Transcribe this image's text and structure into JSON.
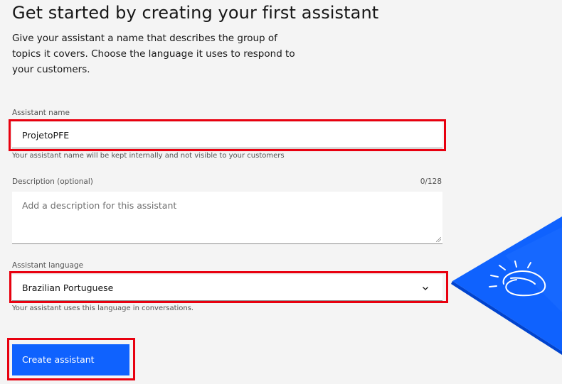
{
  "header": {
    "title": "Get started by creating your first assistant",
    "intro": "Give your assistant a name that describes the group of topics it covers. Choose the language it uses to respond to your customers."
  },
  "form": {
    "name": {
      "label": "Assistant name",
      "value": "ProjetoPFE",
      "helper": "Your assistant name will be kept internally and not visible to your customers"
    },
    "description": {
      "label": "Description (optional)",
      "counter": "0/128",
      "placeholder": "Add a description for this assistant"
    },
    "language": {
      "label": "Assistant language",
      "selected": "Brazilian Portuguese",
      "helper": "Your assistant uses this language in conversations."
    },
    "create_button": "Create assistant"
  },
  "icons": {
    "select_chevron": "chevron-down-icon",
    "illustration": "watson-planet-illustration"
  },
  "colors": {
    "background": "#f4f4f4",
    "primary_button": "#0f62fe",
    "highlight": "#e8000f",
    "illustration_blue": "#0f62fe"
  }
}
